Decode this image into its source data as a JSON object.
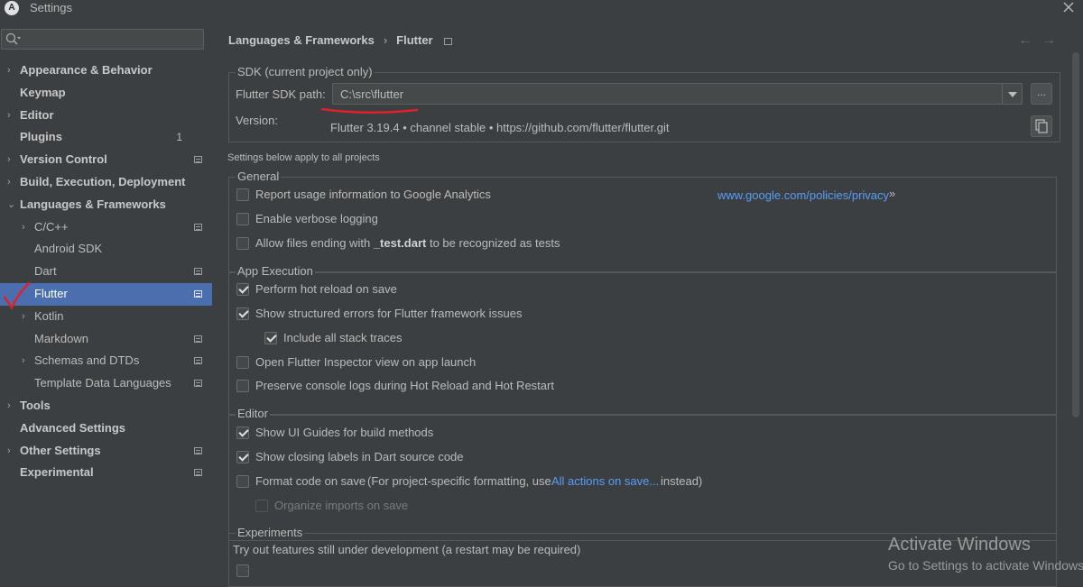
{
  "window": {
    "title": "Settings"
  },
  "search": {
    "placeholder": "",
    "value": ""
  },
  "sidebar": {
    "items": [
      {
        "label": "Appearance & Behavior",
        "arrow": "›"
      },
      {
        "label": "Keymap"
      },
      {
        "label": "Editor",
        "arrow": "›"
      },
      {
        "label": "Plugins",
        "badge": "1"
      },
      {
        "label": "Version Control",
        "arrow": "›"
      },
      {
        "label": "Build, Execution, Deployment",
        "arrow": "›"
      },
      {
        "label": "Languages & Frameworks",
        "arrow": "⌄"
      },
      {
        "label": "C/C++",
        "arrow": "›"
      },
      {
        "label": "Android SDK"
      },
      {
        "label": "Dart"
      },
      {
        "label": "Flutter"
      },
      {
        "label": "Kotlin",
        "arrow": "›"
      },
      {
        "label": "Markdown"
      },
      {
        "label": "Schemas and DTDs",
        "arrow": "›"
      },
      {
        "label": "Template Data Languages"
      },
      {
        "label": "Tools",
        "arrow": "›"
      },
      {
        "label": "Advanced Settings"
      },
      {
        "label": "Other Settings",
        "arrow": "›"
      },
      {
        "label": "Experimental"
      }
    ]
  },
  "breadcrumb": {
    "parent": "Languages & Frameworks",
    "separator": "›",
    "current": "Flutter"
  },
  "nav_arrows": {
    "back": "←",
    "forward": "→"
  },
  "sdk": {
    "group_title": "SDK (current project only)",
    "path_label": "Flutter SDK path:",
    "path_value": "C:\\src\\flutter",
    "browse_label": "...",
    "version_label": "Version:",
    "version_value": "Flutter 3.19.4 • channel stable • https://github.com/flutter/flutter.git"
  },
  "note": "Settings below apply to all projects",
  "general": {
    "title": "General",
    "report_usage": "Report usage information to Google Analytics",
    "privacy_link": "www.google.com/policies/privacy",
    "privacy_arrow": "»",
    "verbose_logging": "Enable verbose logging",
    "allow_test_prefix": "Allow files ending with",
    "allow_test_bold": "_test.dart",
    "allow_test_suffix": "to be recognized as tests"
  },
  "app_execution": {
    "title": "App Execution",
    "hot_reload": "Perform hot reload on save",
    "structured_errors": "Show structured errors for Flutter framework issues",
    "stack_traces": "Include all stack traces",
    "open_inspector": "Open Flutter Inspector view on app launch",
    "preserve_logs": "Preserve console logs during Hot Reload and Hot Restart"
  },
  "editor": {
    "title": "Editor",
    "ui_guides": "Show UI Guides for build methods",
    "closing_labels": "Show closing labels in Dart source code",
    "format_on_save": "Format code on save",
    "format_hint_prefix": "(For project-specific formatting, use",
    "format_hint_link": "All actions on save...",
    "format_hint_suffix": "instead)",
    "organize_imports": "Organize imports on save"
  },
  "experiments": {
    "title": "Experiments",
    "description": "Try out features still under development (a restart may be required)"
  },
  "watermark": {
    "line1": "Activate Windows",
    "line2": "Go to Settings to activate Windows."
  },
  "colors": {
    "selection": "#4b6eaf",
    "link": "#589df6",
    "annotation": "#e0202a"
  }
}
